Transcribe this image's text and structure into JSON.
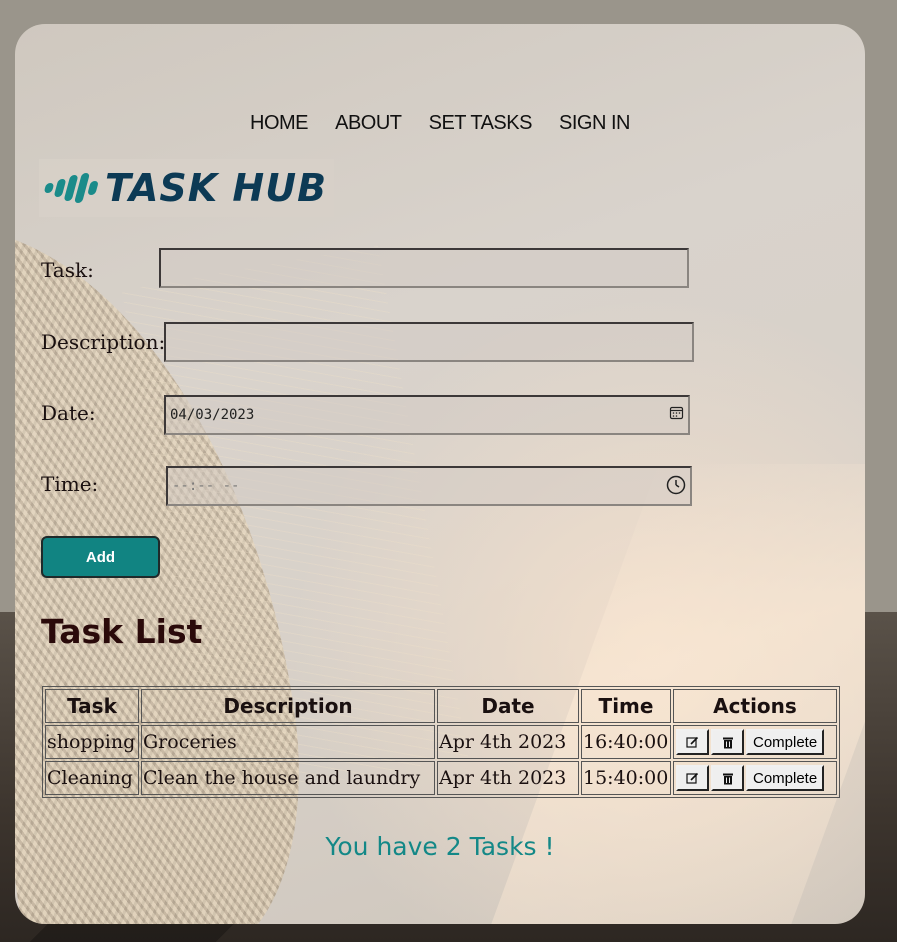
{
  "nav": {
    "items": [
      "HOME",
      "ABOUT",
      "SET TASKS",
      "SIGN IN"
    ]
  },
  "logo": {
    "text": "TASK HUB"
  },
  "form": {
    "task_label": "Task:",
    "task_value": "",
    "description_label": "Description:",
    "description_value": "",
    "date_label": "Date:",
    "date_value": "04/03/2023",
    "time_label": "Time:",
    "time_value": "--:-- --",
    "add_label": "Add"
  },
  "task_list": {
    "title": "Task List",
    "headers": [
      "Task",
      "Description",
      "Date",
      "Time",
      "Actions"
    ],
    "rows": [
      {
        "task": "shopping",
        "description": "Groceries",
        "date": "Apr 4th 2023",
        "time": "16:40:00"
      },
      {
        "task": "Cleaning",
        "description": "Clean the house and laundry",
        "date": "Apr 4th 2023",
        "time": "15:40:00"
      }
    ],
    "complete_label": "Complete"
  },
  "summary": "You have 2 Tasks !",
  "colors": {
    "accent": "#118482",
    "logo_text": "#0c3a55",
    "summary_text": "#138887"
  },
  "icons": {
    "edit": "edit-icon",
    "delete": "trash-icon",
    "calendar": "calendar-icon",
    "clock": "clock-icon"
  }
}
